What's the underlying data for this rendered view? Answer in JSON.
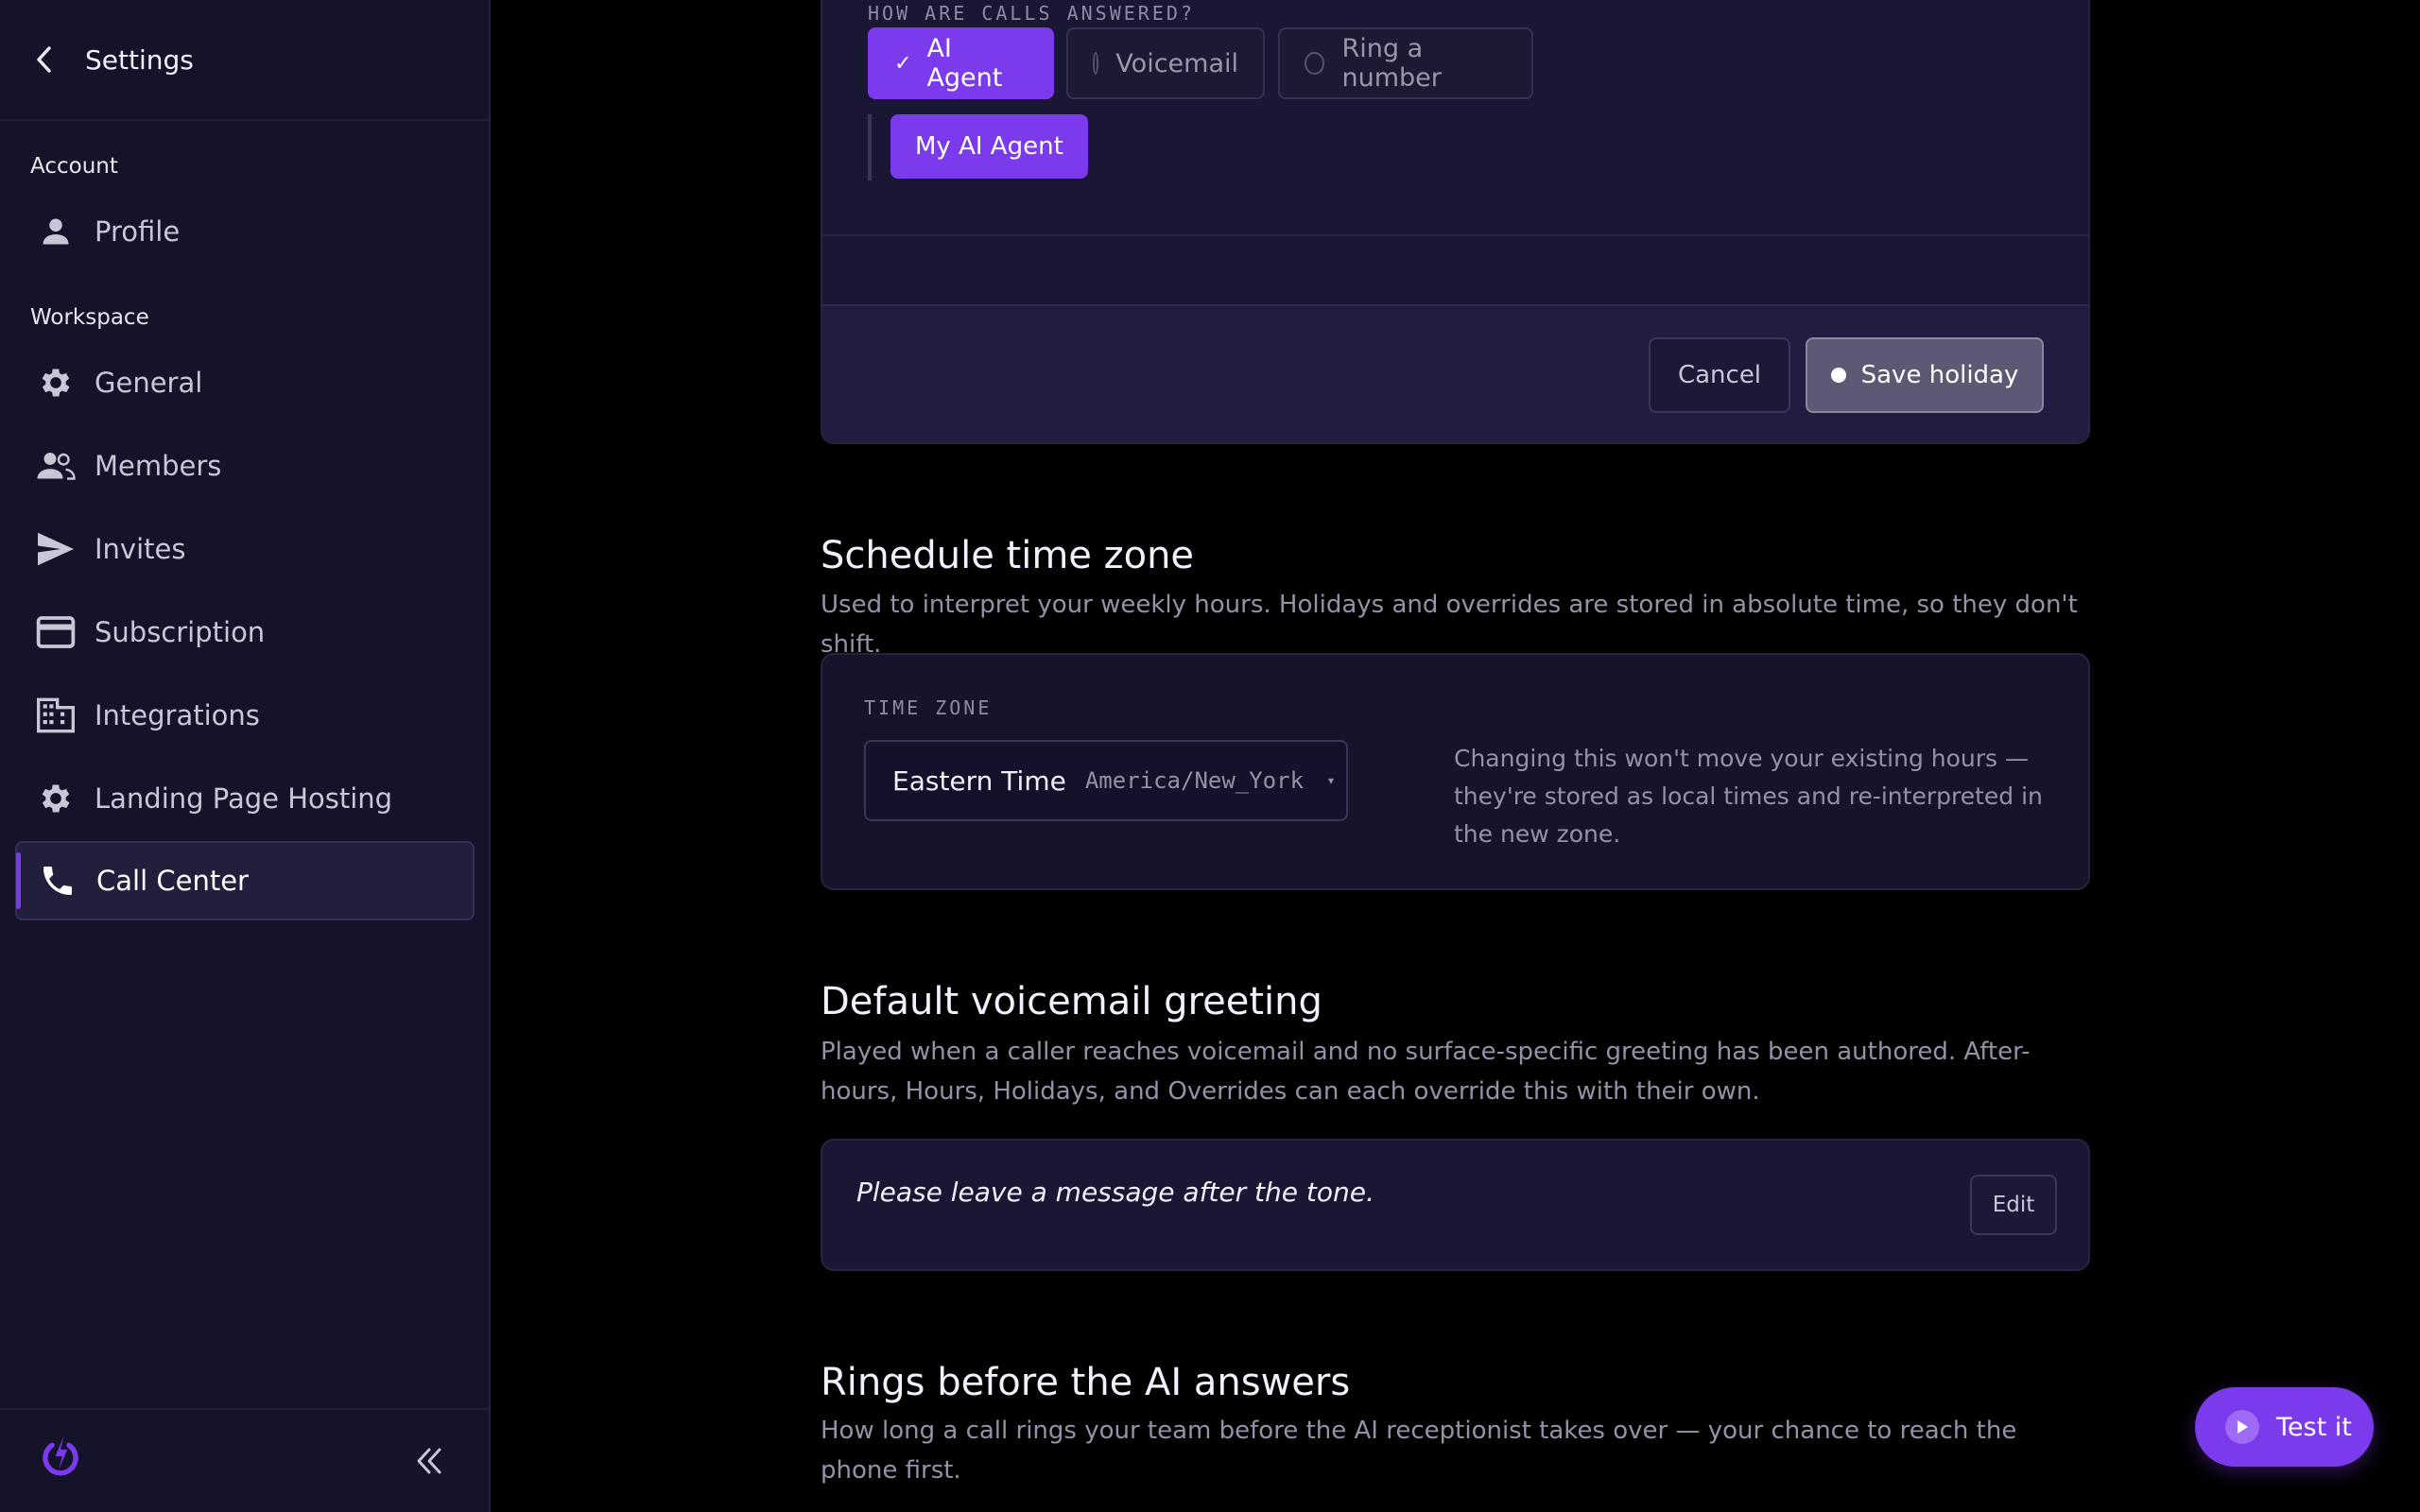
{
  "sidebar": {
    "title": "Settings",
    "sections": {
      "account": "Account",
      "workspace": "Workspace"
    },
    "items": [
      {
        "label": "Profile",
        "icon": "person-icon"
      },
      {
        "label": "General",
        "icon": "gear-icon"
      },
      {
        "label": "Members",
        "icon": "people-icon"
      },
      {
        "label": "Invites",
        "icon": "send-icon"
      },
      {
        "label": "Subscription",
        "icon": "credit-card-icon"
      },
      {
        "label": "Integrations",
        "icon": "building-icon"
      },
      {
        "label": "Landing Page Hosting",
        "icon": "gear-icon"
      },
      {
        "label": "Call Center",
        "icon": "phone-icon",
        "active": true
      }
    ]
  },
  "holiday": {
    "question": "HOW ARE CALLS ANSWERED?",
    "options": [
      "AI Agent",
      "Voicemail",
      "Ring a number"
    ],
    "selected": "AI Agent",
    "agent_label": "My AI Agent",
    "cancel_label": "Cancel",
    "save_label": "Save holiday"
  },
  "timezone": {
    "title": "Schedule time zone",
    "description": "Used to interpret your weekly hours. Holidays and overrides are stored in absolute time, so they don't shift.",
    "field_label": "TIME ZONE",
    "value_name": "Eastern Time",
    "value_id": "America/New_York",
    "note": "Changing this won't move your existing hours — they're stored as local times and re-interpreted in the new zone."
  },
  "voicemail": {
    "title": "Default voicemail greeting",
    "description": "Played when a caller reaches voicemail and no surface-specific greeting has been authored. After-hours, Hours, Holidays, and Overrides can each override this with their own.",
    "greeting": "Please leave a message after the tone.",
    "edit_label": "Edit"
  },
  "rings": {
    "title": "Rings before the AI answers",
    "description": "How long a call rings your team before the AI receptionist takes over — your chance to reach the phone first."
  },
  "test_button": {
    "label": "Test it"
  },
  "colors": {
    "accent": "#7c3aed",
    "sidebar_bg": "#15132a",
    "card_bg": "#16142a"
  }
}
